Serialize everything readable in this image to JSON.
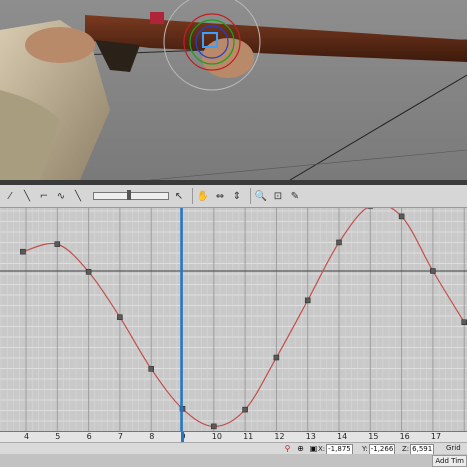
{
  "graph_editor": {
    "frame_ticks": [
      "4",
      "5",
      "6",
      "7",
      "8",
      "9",
      "10",
      "11",
      "12",
      "13",
      "14",
      "15",
      "16",
      "17"
    ],
    "current_frame": "9",
    "curve_keys": [
      {
        "frame": 3.9,
        "value": 46
      },
      {
        "frame": 5.0,
        "value": 64
      },
      {
        "frame": 6.0,
        "value": -2
      },
      {
        "frame": 7.0,
        "value": -110
      },
      {
        "frame": 8.0,
        "value": -233
      },
      {
        "frame": 9.0,
        "value": -328
      },
      {
        "frame": 10.0,
        "value": -370
      },
      {
        "frame": 11.0,
        "value": -330
      },
      {
        "frame": 12.0,
        "value": -206
      },
      {
        "frame": 13.0,
        "value": -70
      },
      {
        "frame": 14.0,
        "value": 68
      },
      {
        "frame": 15.0,
        "value": 155
      },
      {
        "frame": 16.0,
        "value": 130
      },
      {
        "frame": 17.0,
        "value": 0
      },
      {
        "frame": 18.0,
        "value": -122
      }
    ],
    "curve_color": "#c0504d",
    "time_marker_color": "#1f78c8"
  },
  "status": {
    "x_label": "X:",
    "x_value": "-1,875",
    "y_label": "Y:",
    "y_value": "-1,266",
    "z_label": "Z:",
    "z_value": "6,591",
    "grid_label": "Grid =",
    "add_button": "Add Tim"
  },
  "icons": [
    "hand-pan-icon",
    "fit-horizontal-icon",
    "fit-vertical-icon",
    "zoom-icon",
    "zoom-region-icon",
    "tangent-icon"
  ]
}
